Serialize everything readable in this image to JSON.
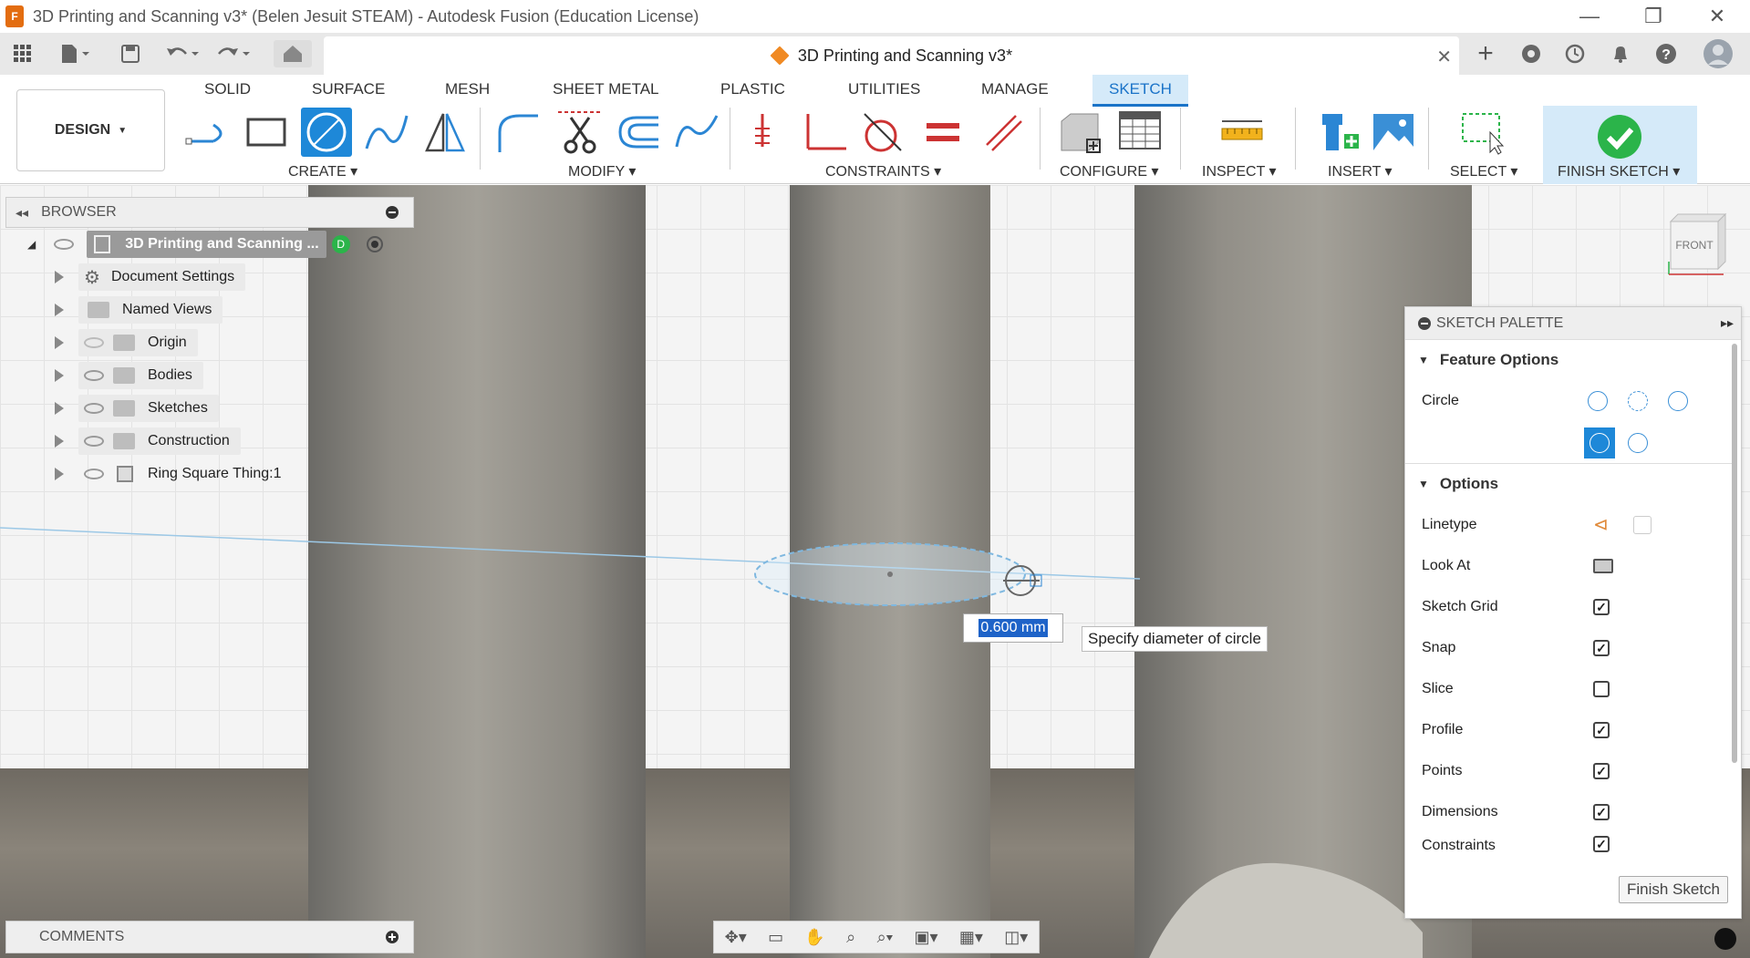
{
  "window": {
    "app_icon": "F",
    "title": "3D Printing and Scanning v3* (Belen Jesuit STEAM) - Autodesk Fusion (Education License)",
    "minimize": "—",
    "restore": "❐",
    "close": "✕"
  },
  "document_tab": {
    "title": "3D Printing and Scanning v3*",
    "close": "✕"
  },
  "ribbon": {
    "workspace": "DESIGN",
    "tabs": [
      "SOLID",
      "SURFACE",
      "MESH",
      "SHEET METAL",
      "PLASTIC",
      "UTILITIES",
      "MANAGE",
      "SKETCH"
    ],
    "groups": [
      "CREATE",
      "MODIFY",
      "CONSTRAINTS",
      "CONFIGURE",
      "INSPECT",
      "INSERT",
      "SELECT",
      "FINISH SKETCH"
    ]
  },
  "browser": {
    "title": "BROWSER",
    "root": "3D Printing and Scanning ...",
    "items": [
      "Document Settings",
      "Named Views",
      "Origin",
      "Bodies",
      "Sketches",
      "Construction",
      "Ring Square Thing:1"
    ]
  },
  "canvas": {
    "diameter_value": "0.600 mm",
    "tooltip": "Specify diameter of circle",
    "viewcube_label": "FRONT"
  },
  "palette": {
    "title": "SKETCH PALETTE",
    "feature_options": "Feature Options",
    "circle_label": "Circle",
    "options": "Options",
    "rows": [
      {
        "label": "Linetype",
        "checked": null
      },
      {
        "label": "Look At",
        "checked": null
      },
      {
        "label": "Sketch Grid",
        "checked": true
      },
      {
        "label": "Snap",
        "checked": true
      },
      {
        "label": "Slice",
        "checked": false
      },
      {
        "label": "Profile",
        "checked": true
      },
      {
        "label": "Points",
        "checked": true
      },
      {
        "label": "Dimensions",
        "checked": true
      },
      {
        "label": "Constraints",
        "checked": true
      }
    ],
    "finish_button": "Finish Sketch",
    "check_mark": "✓"
  },
  "comments": {
    "title": "COMMENTS"
  },
  "colors": {
    "accent": "#1e88d8",
    "tab_active_bg": "#d5eaf9",
    "finish_green": "#2bb44a"
  }
}
